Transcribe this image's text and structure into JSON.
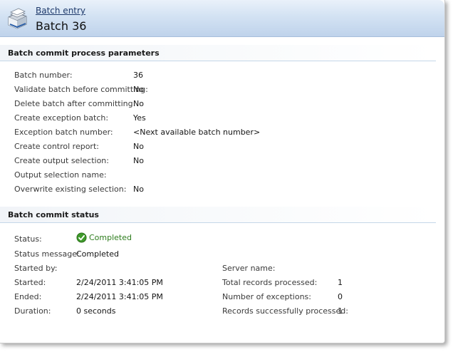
{
  "header": {
    "breadcrumb": "Batch entry",
    "title": "Batch 36"
  },
  "params": {
    "title": "Batch commit process parameters",
    "rows": [
      {
        "label": "Batch number:",
        "value": "36"
      },
      {
        "label": "Validate batch before committing:",
        "value": "No"
      },
      {
        "label": "Delete batch after committing:",
        "value": "No"
      },
      {
        "label": "Create exception batch:",
        "value": "Yes"
      },
      {
        "label": "Exception batch number:",
        "value": "<Next available batch number>"
      },
      {
        "label": "Create control report:",
        "value": "No"
      },
      {
        "label": "Create output selection:",
        "value": "No"
      },
      {
        "label": "Output selection name:",
        "value": ""
      },
      {
        "label": "Overwrite existing selection:",
        "value": "No"
      }
    ]
  },
  "status": {
    "title": "Batch commit status",
    "status_label": "Status:",
    "status_value": "Completed",
    "status_icon": "check-circle-icon",
    "status_color": "#2e7d1e",
    "message_label": "Status message:",
    "message_value": "Completed",
    "started_by_label": "Started by:",
    "started_by_value": "",
    "started_label": "Started:",
    "started_value": "2/24/2011 3:41:05 PM",
    "ended_label": "Ended:",
    "ended_value": "2/24/2011 3:41:05 PM",
    "duration_label": "Duration:",
    "duration_value": "0 seconds",
    "server_label": "Server name:",
    "server_value": "",
    "total_label": "Total records processed:",
    "total_value": "1",
    "exceptions_label": "Number of exceptions:",
    "exceptions_value": "0",
    "success_label": "Records successfully processed:",
    "success_value": "1"
  }
}
